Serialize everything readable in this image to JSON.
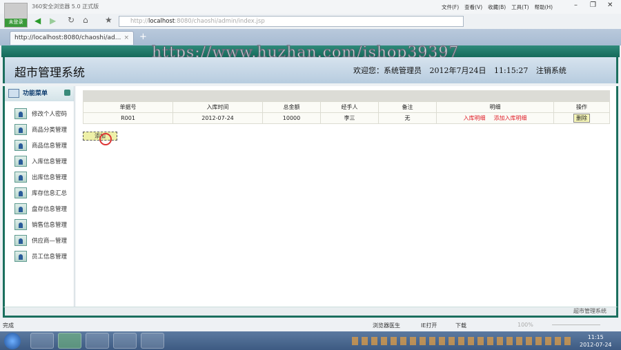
{
  "browser": {
    "title": "360安全浏览器 5.0 正式版",
    "menu": [
      "文件(F)",
      "查看(V)",
      "收藏(B)",
      "工具(T)",
      "帮助(H)"
    ],
    "url_host": "localhost",
    "url_rest": ":8080/chaoshi/admin/index.jsp",
    "url_prefix": "http://",
    "tab_label": "http://localhost:8080/chaoshi/ad...",
    "login_label": "未登录"
  },
  "watermark": "https://www.huzhan.com/ishop39397",
  "app": {
    "title": "超市管理系统",
    "welcome": "欢迎您：系统管理员",
    "datetime": "2012年7月24日 11:15:27",
    "logout": "注销系统",
    "footer": "超市管理系统"
  },
  "sidebar": {
    "title": "功能菜单",
    "items": [
      "修改个人密码",
      "商品分类管理",
      "商品信息管理",
      "入库信息管理",
      "出库信息管理",
      "库存信息汇总",
      "盘存信息管理",
      "销售信息管理",
      "供应商—管理",
      "员工信息管理"
    ]
  },
  "table": {
    "headers": [
      "单据号",
      "入库时间",
      "总金额",
      "经手人",
      "备注",
      "明细",
      "操作"
    ],
    "rows": [
      {
        "id": "R001",
        "date": "2012-07-24",
        "amount": "10000",
        "handler": "李三",
        "note": "无",
        "detail": "入库明细",
        "add_detail": "添加入库明细",
        "action": "删除"
      }
    ]
  },
  "add_button": "添加",
  "statusbar": {
    "left": "完成",
    "doctor": "浏览器医生",
    "ie": "IE打开",
    "download": "下载",
    "zoom": "100%"
  },
  "taskbar": {
    "time": "11:15",
    "date": "2012-07-24"
  }
}
